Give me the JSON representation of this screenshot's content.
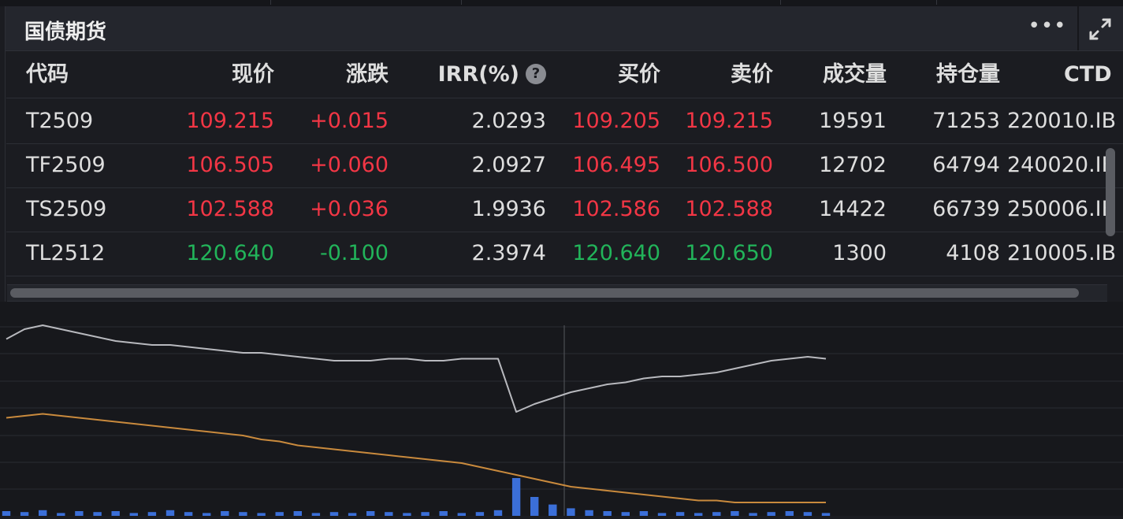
{
  "panel": {
    "title": "国债期货",
    "more_label": "•••",
    "colors": {
      "up": "#f23645",
      "down": "#22b45a",
      "accent_blue": "#3b6fd8",
      "line_gray": "#b8b9be",
      "line_orange": "#c98a3d"
    },
    "icons": {
      "more": "more-dots-icon",
      "expand": "expand-icon",
      "help": "help-circle-icon"
    }
  },
  "table": {
    "columns": [
      "代码",
      "现价",
      "涨跌",
      "IRR(%)",
      "买价",
      "卖价",
      "成交量",
      "持仓量",
      "CTD"
    ],
    "help_glyph": "?",
    "rows": [
      {
        "code": "T2509",
        "price": "109.215",
        "change": "+0.015",
        "irr": "2.0293",
        "bid": "109.205",
        "ask": "109.215",
        "volume": "19591",
        "open_interest": "71253",
        "ctd": "220010.IB",
        "dir": "up"
      },
      {
        "code": "TF2509",
        "price": "106.505",
        "change": "+0.060",
        "irr": "2.0927",
        "bid": "106.495",
        "ask": "106.500",
        "volume": "12702",
        "open_interest": "64794",
        "ctd": "240020.IB",
        "dir": "up"
      },
      {
        "code": "TS2509",
        "price": "102.588",
        "change": "+0.036",
        "irr": "1.9936",
        "bid": "102.586",
        "ask": "102.588",
        "volume": "14422",
        "open_interest": "66739",
        "ctd": "250006.IB",
        "dir": "up"
      },
      {
        "code": "TL2512",
        "price": "120.640",
        "change": "-0.100",
        "irr": "2.3974",
        "bid": "120.640",
        "ask": "120.650",
        "volume": "1300",
        "open_interest": "4108",
        "ctd": "210005.IB",
        "dir": "down"
      }
    ]
  },
  "chart_data": {
    "type": "line",
    "series": [
      {
        "values": [
          0.85,
          0.9,
          0.92,
          0.9,
          0.88,
          0.86,
          0.84,
          0.83,
          0.82,
          0.82,
          0.81,
          0.8,
          0.79,
          0.78,
          0.78,
          0.77,
          0.76,
          0.75,
          0.74,
          0.74,
          0.74,
          0.75,
          0.75,
          0.74,
          0.74,
          0.75,
          0.75,
          0.75,
          0.48,
          0.52,
          0.55,
          0.58,
          0.6,
          0.62,
          0.63,
          0.65,
          0.66,
          0.66,
          0.67,
          0.68,
          0.7,
          0.72,
          0.74,
          0.75,
          0.76,
          0.75
        ]
      },
      {
        "values": [
          0.45,
          0.46,
          0.47,
          0.46,
          0.45,
          0.44,
          0.43,
          0.42,
          0.41,
          0.4,
          0.39,
          0.38,
          0.37,
          0.36,
          0.34,
          0.33,
          0.31,
          0.3,
          0.29,
          0.28,
          0.27,
          0.26,
          0.25,
          0.24,
          0.23,
          0.22,
          0.2,
          0.18,
          0.16,
          0.14,
          0.12,
          0.1,
          0.09,
          0.08,
          0.07,
          0.06,
          0.05,
          0.04,
          0.03,
          0.03,
          0.02,
          0.02,
          0.02,
          0.02,
          0.02,
          0.02
        ]
      },
      {
        "type": "bar",
        "values": [
          5,
          4,
          6,
          3,
          5,
          4,
          5,
          3,
          4,
          6,
          4,
          3,
          5,
          4,
          3,
          4,
          5,
          3,
          4,
          3,
          5,
          4,
          3,
          4,
          5,
          3,
          4,
          6,
          40,
          20,
          12,
          8,
          6,
          5,
          4,
          5,
          3,
          4,
          3,
          4,
          5,
          3,
          4,
          5,
          4,
          3
        ]
      }
    ]
  }
}
